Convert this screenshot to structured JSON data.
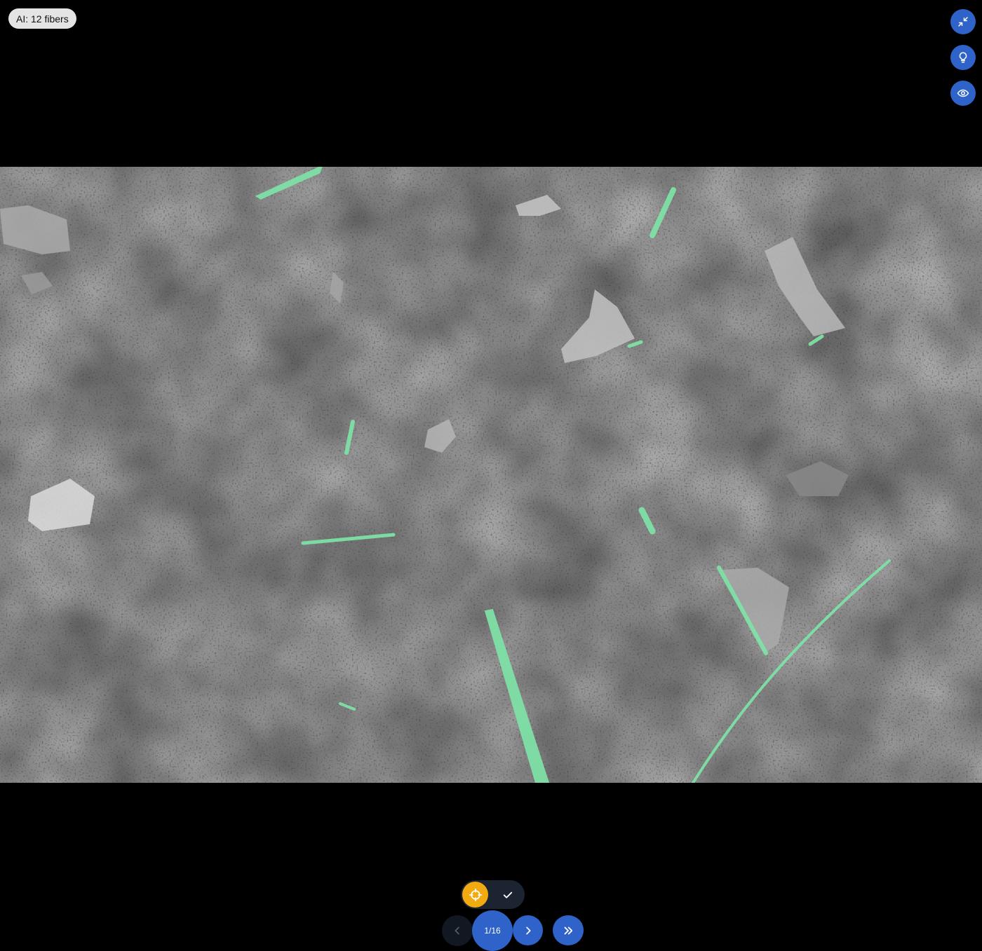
{
  "ai_badge": {
    "text": "AI: 12 fibers"
  },
  "side_controls": [
    {
      "name": "collapse",
      "icon": "collapse-arrows-icon"
    },
    {
      "name": "hint",
      "icon": "lightbulb-icon"
    },
    {
      "name": "visibility",
      "icon": "eye-icon"
    }
  ],
  "image": {
    "description_icon": "sem-micrograph",
    "fiber_color": "#7fe3a7",
    "fiber_count": 12
  },
  "mode_toggle": {
    "active": "target",
    "target_icon": "crosshair-icon",
    "confirm_icon": "check-icon"
  },
  "pagination": {
    "current": 1,
    "total": 16,
    "label": "1/16"
  },
  "colors": {
    "accent": "#2f63c9",
    "target": "#f2aa11",
    "background": "#000000"
  }
}
